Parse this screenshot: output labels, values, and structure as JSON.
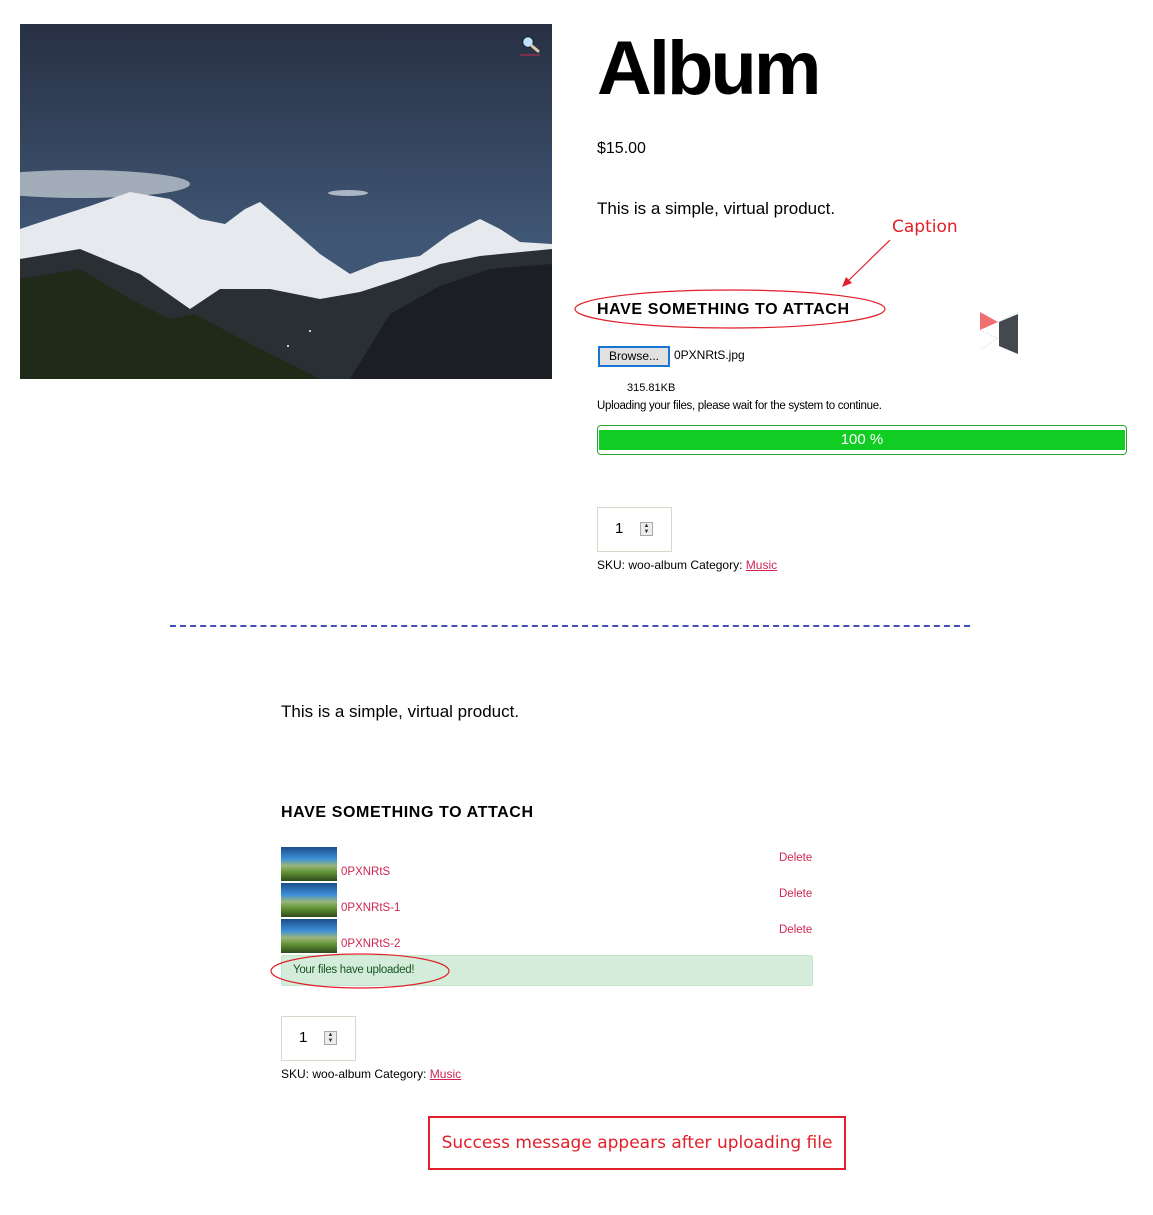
{
  "product": {
    "title": "Album",
    "price": "$15.00",
    "short_description": "This is a simple, virtual product.",
    "image_alt": "Snow-capped mountains at night",
    "zoom_icon": "magnifier-icon"
  },
  "attach_section": {
    "heading": "HAVE SOMETHING TO ATTACH",
    "browse_label": "Browse...",
    "selected_file": "0PXNRtS.jpg",
    "file_size": "315.81KB",
    "upload_message": "Uploading your files, please wait for the system to continue.",
    "progress": {
      "percent": 100,
      "label": "100 %"
    }
  },
  "cart": {
    "quantity": "1",
    "sku_label": "SKU:",
    "sku_value": "woo-album",
    "category_label": "Category:",
    "category_link": "Music"
  },
  "after_upload": {
    "short_description": "This is a simple, virtual product.",
    "heading": "HAVE SOMETHING TO ATTACH",
    "files": [
      {
        "name": "0PXNRtS",
        "delete_label": "Delete"
      },
      {
        "name": "0PXNRtS-1",
        "delete_label": "Delete"
      },
      {
        "name": "0PXNRtS-2",
        "delete_label": "Delete"
      }
    ],
    "success_message": "Your files have uploaded!",
    "quantity": "1",
    "sku_label": "SKU:",
    "sku_value": "woo-album",
    "category_label": "Category:",
    "category_link": "Music"
  },
  "annotations": {
    "caption_label": "Caption",
    "note": "Success message appears after uploading file",
    "color": "#e0202a"
  },
  "colors": {
    "link": "#cd2653",
    "progress_fill": "#11cc22",
    "success_bg": "#d4edda",
    "divider": "#4350b8"
  }
}
